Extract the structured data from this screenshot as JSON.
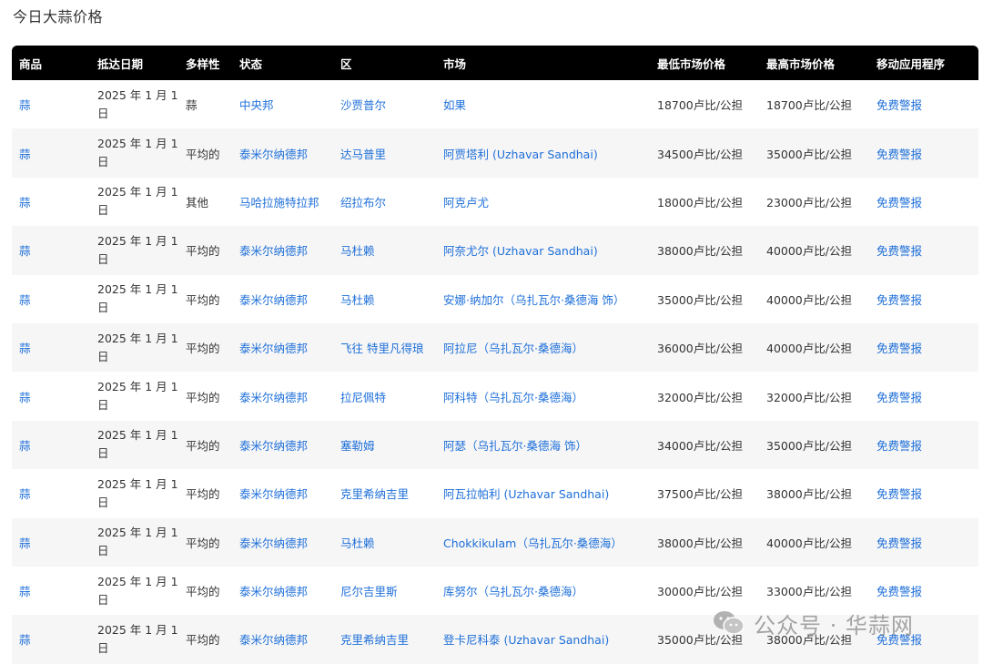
{
  "page": {
    "title": "今日大蒜价格"
  },
  "table": {
    "headers": [
      "商品",
      "抵达日期",
      "多样性",
      "状态",
      "区",
      "市场",
      "最低市场价格",
      "最高市场价格",
      "移动应用程序"
    ],
    "rows": [
      {
        "commodity": "蒜",
        "date": "2025 年 1 月 1 日",
        "variety": "蒜",
        "state": "中央邦",
        "district": "沙贾普尔",
        "market": "如果",
        "min_price": "18700卢比/公担",
        "max_price": "18700卢比/公担",
        "app": "免费警报"
      },
      {
        "commodity": "蒜",
        "date": "2025 年 1 月 1 日",
        "variety": "平均的",
        "state": "泰米尔纳德邦",
        "district": "达马普里",
        "market": "阿贾塔利 (Uzhavar Sandhai)",
        "min_price": "34500卢比/公担",
        "max_price": "35000卢比/公担",
        "app": "免费警报"
      },
      {
        "commodity": "蒜",
        "date": "2025 年 1 月 1 日",
        "variety": "其他",
        "state": "马哈拉施特拉邦",
        "district": "绍拉布尔",
        "market": "阿克卢尤",
        "min_price": "18000卢比/公担",
        "max_price": "23000卢比/公担",
        "app": "免费警报"
      },
      {
        "commodity": "蒜",
        "date": "2025 年 1 月 1 日",
        "variety": "平均的",
        "state": "泰米尔纳德邦",
        "district": "马杜赖",
        "market": "阿奈尤尔 (Uzhavar Sandhai)",
        "min_price": "38000卢比/公担",
        "max_price": "40000卢比/公担",
        "app": "免费警报"
      },
      {
        "commodity": "蒜",
        "date": "2025 年 1 月 1 日",
        "variety": "平均的",
        "state": "泰米尔纳德邦",
        "district": "马杜赖",
        "market": "安娜·纳加尔（乌扎瓦尔·桑德海 饰）",
        "min_price": "35000卢比/公担",
        "max_price": "40000卢比/公担",
        "app": "免费警报"
      },
      {
        "commodity": "蒜",
        "date": "2025 年 1 月 1 日",
        "variety": "平均的",
        "state": "泰米尔纳德邦",
        "district": "飞往 特里凡得琅",
        "market": "阿拉尼（乌扎瓦尔·桑德海）",
        "min_price": "36000卢比/公担",
        "max_price": "40000卢比/公担",
        "app": "免费警报"
      },
      {
        "commodity": "蒜",
        "date": "2025 年 1 月 1 日",
        "variety": "平均的",
        "state": "泰米尔纳德邦",
        "district": "拉尼佩特",
        "market": "阿科特（乌扎瓦尔·桑德海）",
        "min_price": "32000卢比/公担",
        "max_price": "32000卢比/公担",
        "app": "免费警报"
      },
      {
        "commodity": "蒜",
        "date": "2025 年 1 月 1 日",
        "variety": "平均的",
        "state": "泰米尔纳德邦",
        "district": "塞勒姆",
        "market": "阿瑟（乌扎瓦尔·桑德海 饰）",
        "min_price": "34000卢比/公担",
        "max_price": "35000卢比/公担",
        "app": "免费警报"
      },
      {
        "commodity": "蒜",
        "date": "2025 年 1 月 1 日",
        "variety": "平均的",
        "state": "泰米尔纳德邦",
        "district": "克里希纳吉里",
        "market": "阿瓦拉帕利 (Uzhavar Sandhai)",
        "min_price": "37500卢比/公担",
        "max_price": "38000卢比/公担",
        "app": "免费警报"
      },
      {
        "commodity": "蒜",
        "date": "2025 年 1 月 1 日",
        "variety": "平均的",
        "state": "泰米尔纳德邦",
        "district": "马杜赖",
        "market": "Chokkikulam（乌扎瓦尔·桑德海）",
        "min_price": "38000卢比/公担",
        "max_price": "40000卢比/公担",
        "app": "免费警报"
      },
      {
        "commodity": "蒜",
        "date": "2025 年 1 月 1 日",
        "variety": "平均的",
        "state": "泰米尔纳德邦",
        "district": "尼尔吉里斯",
        "market": "库努尔（乌扎瓦尔·桑德海）",
        "min_price": "30000卢比/公担",
        "max_price": "33000卢比/公担",
        "app": "免费警报"
      },
      {
        "commodity": "蒜",
        "date": "2025 年 1 月 1 日",
        "variety": "平均的",
        "state": "泰米尔纳德邦",
        "district": "克里希纳吉里",
        "market": "登卡尼科泰 (Uzhavar Sandhai)",
        "min_price": "35000卢比/公担",
        "max_price": "38000卢比/公担",
        "app": "免费警报"
      }
    ]
  },
  "watermark": {
    "text": "公众号 · 华蒜网",
    "icon": "wechat-icon"
  },
  "colors": {
    "header_bg": "#000000",
    "link": "#1e6fd9",
    "row_alt": "#f6f6f6"
  }
}
